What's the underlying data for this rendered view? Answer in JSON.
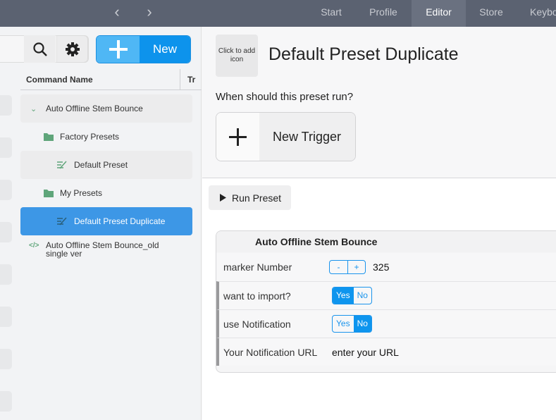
{
  "nav": {
    "back_icon": "chevron-left-icon",
    "forward_icon": "chevron-right-icon",
    "tabs": [
      {
        "label": "Start"
      },
      {
        "label": "Profile"
      },
      {
        "label": "Editor",
        "active": true
      },
      {
        "label": "Store"
      },
      {
        "label": "Keybo"
      }
    ]
  },
  "sidebar": {
    "new_label": "New",
    "column_header": "Command Name",
    "column_header_2": "Tr",
    "tree": [
      {
        "label": "Auto Offline Stem Bounce",
        "icon": "chevron-down-icon"
      },
      {
        "label": "Factory Presets",
        "icon": "folder-icon"
      },
      {
        "label": "Default Preset",
        "icon": "preset-icon"
      },
      {
        "label": "My Presets",
        "icon": "folder-icon"
      },
      {
        "label": "Default Preset Duplicate",
        "icon": "preset-icon",
        "selected": true
      },
      {
        "label": "Auto Offline Stem Bounce_old single ver",
        "icon": "code-icon"
      }
    ]
  },
  "editor": {
    "icon_placeholder": "Click to add icon",
    "title": "Default Preset Duplicate",
    "question": "When should this preset run?",
    "new_trigger": "New Trigger",
    "run_preset": "Run Preset",
    "panel": {
      "title": "Auto Offline Stem Bounce",
      "marker_label": "marker Number",
      "marker_minus": "-",
      "marker_plus": "+",
      "marker_value": "325",
      "import_label": "want to import?",
      "import_value": "Yes",
      "notify_label": "use Notification",
      "notify_value": "No",
      "yes": "Yes",
      "no": "No",
      "url_label": "Your Notification URL",
      "url_value": "enter your URL"
    }
  },
  "colors": {
    "accent": "#0e95ee",
    "selected": "#3d97e6",
    "topbar": "#5b6271",
    "folder": "#5fa57a"
  }
}
